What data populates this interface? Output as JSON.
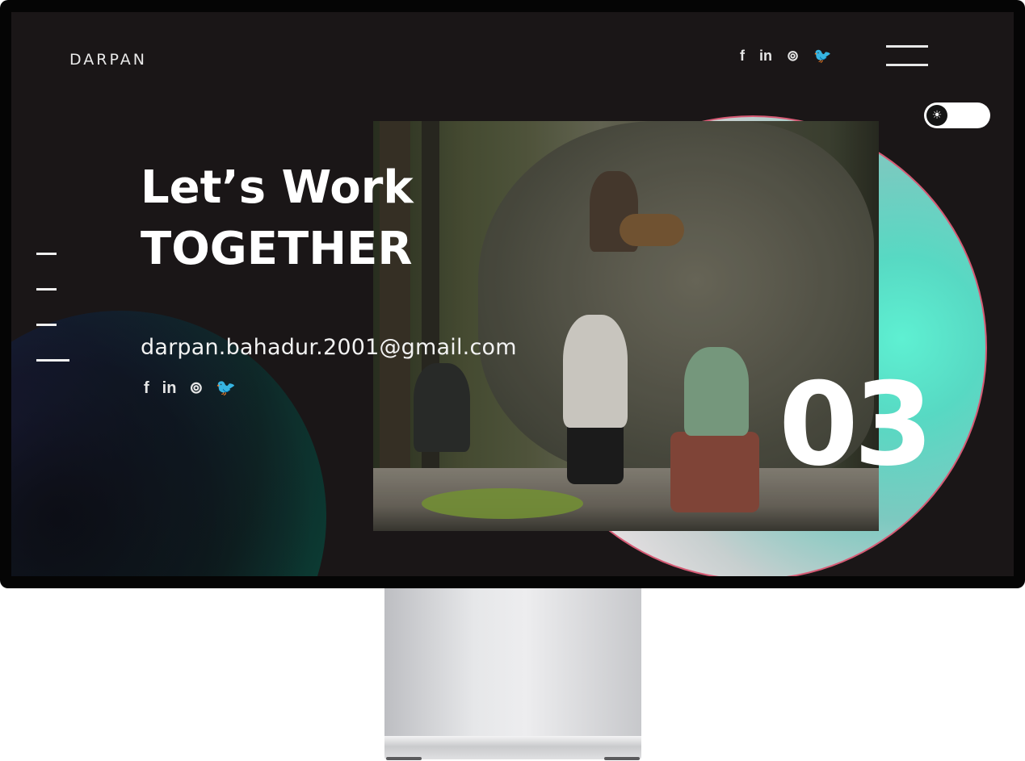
{
  "header": {
    "logo": "DARPAN",
    "social": [
      "f",
      "in",
      "⊚",
      "🐦"
    ]
  },
  "theme_toggle": {
    "icon": "☀"
  },
  "hero": {
    "line1": "Let’s Work",
    "line2": "TOGETHER",
    "email": "darpan.bahadur.2001@gmail.com",
    "social": [
      "f",
      "in",
      "⊚",
      "🐦"
    ],
    "slide_number": "03"
  },
  "slides": {
    "count": 4,
    "active_index": 4
  },
  "colors": {
    "background": "#1a1617",
    "accent_teal": "#5ef0d2",
    "accent_pink": "#d65b75",
    "text": "#ffffff"
  }
}
